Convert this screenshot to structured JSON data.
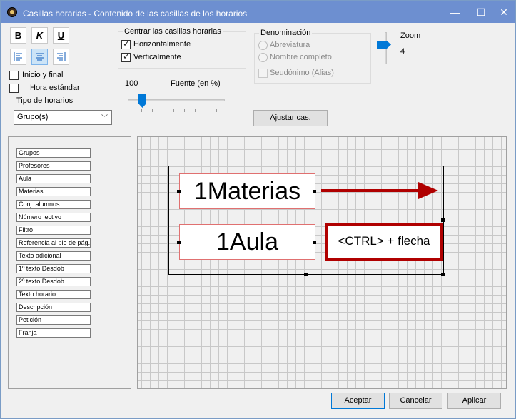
{
  "window": {
    "title": "Casillas horarias - Contenido de las casillas de los horarios",
    "minimize": "—",
    "maximize": "☐",
    "close": "✕"
  },
  "format": {
    "bold": "B",
    "italic": "K",
    "underline": "U"
  },
  "center": {
    "title": "Centrar las casillas horarias",
    "horizontal": "Horizontalmente",
    "vertical": "Verticalmente",
    "horizontal_checked": true,
    "vertical_checked": true
  },
  "denomination": {
    "title": "Denominación",
    "abbrev": "Abreviatura",
    "full_name": "Nombre completo",
    "pseudonym": "Seudónimo (Alias)"
  },
  "zoom": {
    "label": "Zoom",
    "value": "4"
  },
  "options": {
    "start_end": "Inicio y final",
    "standard_time": "Hora estándar"
  },
  "font": {
    "value": "100",
    "label": "Fuente (en %)"
  },
  "schedule_type": {
    "label": "Tipo de horarios",
    "selected": "Grupo(s)"
  },
  "adjust_button": "Ajustar cas.",
  "fields": [
    "Grupos",
    "Profesores",
    "Aula",
    "Materias",
    "Conj. alumnos",
    "Número lectivo",
    "Filtro",
    "Referencia al pie de pág.",
    "Texto adicional",
    "1º texto:Desdob",
    "2º texto:Desdob",
    "Texto horario",
    "Descripción",
    "Petición",
    "Franja"
  ],
  "preview": {
    "cell1": "1Materias",
    "cell2": "1Aula",
    "hint": "<CTRL> + flecha"
  },
  "footer": {
    "accept": "Aceptar",
    "cancel": "Cancelar",
    "apply": "Aplicar"
  }
}
